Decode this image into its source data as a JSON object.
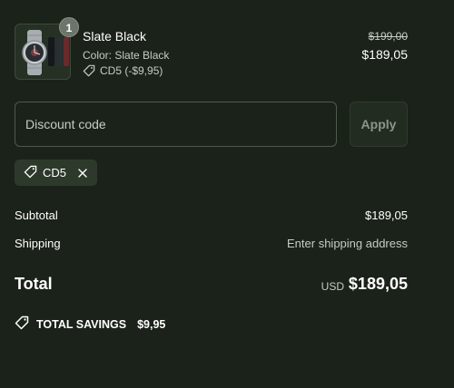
{
  "product": {
    "quantity": "1",
    "name": "Slate Black",
    "color_line": "Color: Slate Black",
    "discount_line": "CD5 (-$9,95)",
    "original_price": "$199,00",
    "price": "$189,05",
    "thumbnail_icon": "watch-image"
  },
  "discount": {
    "placeholder": "Discount code",
    "value": "",
    "apply_label": "Apply"
  },
  "applied_code": {
    "code": "CD5",
    "icon": "tag-icon",
    "remove_icon": "close-icon"
  },
  "summary": {
    "subtotal_label": "Subtotal",
    "subtotal_value": "$189,05",
    "shipping_label": "Shipping",
    "shipping_value": "Enter shipping address",
    "total_label": "Total",
    "total_currency": "USD",
    "total_value": "$189,05",
    "savings_label": "TOTAL SAVINGS",
    "savings_value": "$9,95"
  },
  "colors": {
    "background": "#1b2219",
    "muted_text": "#c5ccc2",
    "chip_bg": "#2d3a2b",
    "border": "#4d5a4a"
  }
}
